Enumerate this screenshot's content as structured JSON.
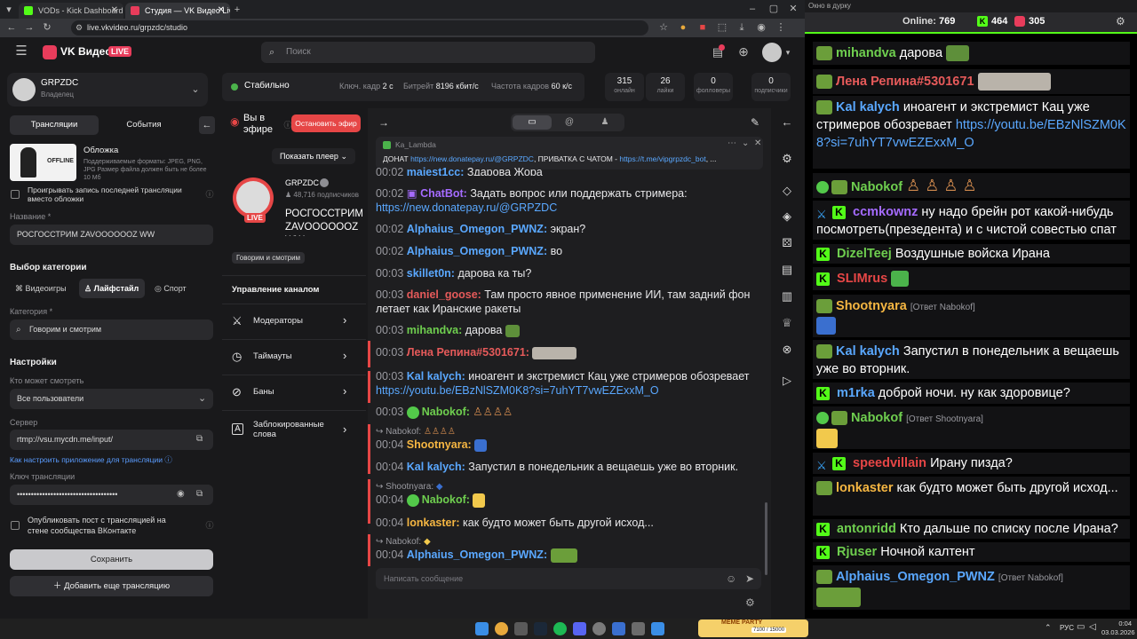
{
  "browser": {
    "tabs": [
      {
        "label": "VODs - Kick Dashboard"
      },
      {
        "label": "Студия — VK Видео Live"
      }
    ],
    "url": "live.vkvideo.ru/grpzdc/studio"
  },
  "vk": {
    "logo_text": "VK Видео",
    "live_badge": "LIVE",
    "search_placeholder": "Поиск",
    "channel": {
      "name": "GRPZDC",
      "role": "Владелец"
    },
    "tabs": {
      "broadcasts": "Трансляции",
      "events": "События"
    },
    "cover": {
      "title": "Обложка",
      "hint": "Поддерживаемые форматы: JPEG, PNG, JPG Размер файла должен быть не более 10 Мб",
      "preview_text": "OFFLINE"
    },
    "replay_checkbox": "Проигрывать запись последней трансляции вместо обложки",
    "name_label": "Название *",
    "name_value": "РОСГОССТРИМ ZAVOOOOOOZ WW",
    "category_section": "Выбор категории",
    "category_tabs": [
      "Видеоигры",
      "Лайфстайл",
      "Спорт"
    ],
    "category_label": "Категория *",
    "category_value": "Говорим и смотрим",
    "settings_title": "Настройки",
    "who_label": "Кто может смотреть",
    "who_value": "Все пользователи",
    "server_label": "Сервер",
    "server_value": "rtmp://vsu.mycdn.me/input/",
    "howto_link": "Как настроить приложение для трансляции",
    "key_label": "Ключ трансляции",
    "key_value": "••••••••••••••••••••••••••••••••••••",
    "publish_checkbox": "Опубликовать пост с трансляцией на стене сообщества ВКонтакте",
    "save_button": "Сохранить",
    "add_button": "Добавить еще трансляцию",
    "status": {
      "label": "Стабильно",
      "keyframe_label": "Ключ. кадр",
      "keyframe_value": "2 с",
      "bitrate_label": "Битрейт",
      "bitrate_value": "8196 кбит/с",
      "fps_label": "Частота кадров",
      "fps_value": "60 к/с"
    },
    "stats": [
      {
        "value": "315",
        "label": "онлайн"
      },
      {
        "value": "26",
        "label": "лайки"
      },
      {
        "value": "0",
        "label": "фолловеры"
      },
      {
        "value": "0",
        "label": "подписчики"
      }
    ],
    "live_status": "Вы в эфире",
    "stop_button": "Остановить эфир",
    "show_player": "Показать плеер",
    "stream_channel": "GRPZDC",
    "subscribers": "48,716 подписчиков",
    "stream_title": "РОСГОССТРИМ ZAVOOOOOOZ WW",
    "category_chip": "Говорим и смотрим",
    "manage_title": "Управление каналом",
    "manage_items": [
      "Модераторы",
      "Таймауты",
      "Баны",
      "Заблокированные слова"
    ],
    "pinned": {
      "author": "Ka_Lambda",
      "text_before": "ДОНАТ ",
      "link1": "https://new.donatepay.ru/@GRPZDC",
      "text_mid": ", ПРИВАТКА С ЧАТОМ - ",
      "link2": "https://t.me/vipgrpzdc_bot",
      "text_after": ", ..."
    },
    "chat_input": "Написать сообщение",
    "messages": [
      {
        "time": "00:02",
        "user": "majest1cc:",
        "text": "Здарова Жора"
      },
      {
        "time": "00:02",
        "user": "ChatBot:",
        "text": "Задать вопрос или поддержать стримера:",
        "link": "https://new.donatepay.ru/@GRPZDC"
      },
      {
        "time": "00:02",
        "user": "Alphaius_Omegon_PWNZ:",
        "text": "экран?"
      },
      {
        "time": "00:02",
        "user": "Alphaius_Omegon_PWNZ:",
        "text": "во"
      },
      {
        "time": "00:03",
        "user": "skillet0n:",
        "text": "дарова ка ты?"
      },
      {
        "time": "00:03",
        "user": "daniel_goose:",
        "text": "Там просто явное применение ИИ, там задний фон летает как Иранские ракеты"
      },
      {
        "time": "00:03",
        "user": "mihandva:",
        "text": "дарова"
      },
      {
        "time": "00:03",
        "user": "Лена Репина#5301671:",
        "text": ""
      },
      {
        "time": "00:03",
        "user": "Kal kalych:",
        "text": "иноагент и экстремист Кац уже стримеров обозревает",
        "link": "https://youtu.be/EBzNlSZM0K8?si=7uhYT7vwEZExxM_O"
      },
      {
        "time": "00:03",
        "user": "Nabokof:",
        "text": ""
      },
      {
        "time": "00:04",
        "user": "Shootnyara:",
        "text": "",
        "reply": "Nabokof:"
      },
      {
        "time": "00:04",
        "user": "Kal kalych:",
        "text": "Запустил в понедельник а вещаешь уже во вторник."
      },
      {
        "time": "00:04",
        "user": "Nabokof:",
        "text": "",
        "reply": "Shootnyara:"
      },
      {
        "time": "00:04",
        "user": "lonkaster:",
        "text": "как будто может быть другой исход..."
      },
      {
        "time": "00:04",
        "user": "Alphaius_Omegon_PWNZ:",
        "text": "",
        "reply": "Nabokof:"
      }
    ]
  },
  "overlay": {
    "title": "Окно в дурку",
    "online_label": "Online:",
    "online_value": "769",
    "kick_value": "464",
    "vk_value": "305",
    "messages": [
      {
        "user": "mihandva",
        "text": "дарова"
      },
      {
        "user": "Лена Репина#5301671",
        "text": ""
      },
      {
        "user": "Kal kalych",
        "text": "иноагент и экстремист Кац уже стримеров обозревает",
        "link": "https://youtu.be/EBzNlSZM0K8?si=7uhYT7vwEZExxM_O"
      },
      {
        "user": "Nabokof",
        "text": ""
      },
      {
        "user": "ccmkownz",
        "text": "ну надо брейн рот какой-нибудь посмотреть(презедента) и с чистой совестью спат"
      },
      {
        "user": "DizelTeej",
        "text": "Воздушные войска Ирана"
      },
      {
        "user": "SLIMrus",
        "text": ""
      },
      {
        "user": "Shootnyara",
        "text": "",
        "reply": "[Ответ Nabokof]"
      },
      {
        "user": "Kal kalych",
        "text": "Запустил в понедельник а вещаешь уже во вторник."
      },
      {
        "user": "m1rka",
        "text": "доброй ночи. ну как здоровице?"
      },
      {
        "user": "Nabokof",
        "text": "",
        "reply": "[Ответ Shootnyara]"
      },
      {
        "user": "speedvillain",
        "text": "Ирану пизда?"
      },
      {
        "user": "lonkaster",
        "text": "как будто может быть другой исход..."
      },
      {
        "user": "antonridd",
        "text": "Кто дальше по списку после Ирана?"
      },
      {
        "user": "Rjuser",
        "text": "Ночной калтент"
      },
      {
        "user": "Alphaius_Omegon_PWNZ",
        "text": "",
        "reply": "[Ответ Nabokof]"
      }
    ]
  },
  "taskbar": {
    "lang": "РУС",
    "time": "0:04",
    "date": "03.03.2026",
    "meme_label": "MEME PARTY",
    "meme_progress": "7100 / 15000"
  }
}
